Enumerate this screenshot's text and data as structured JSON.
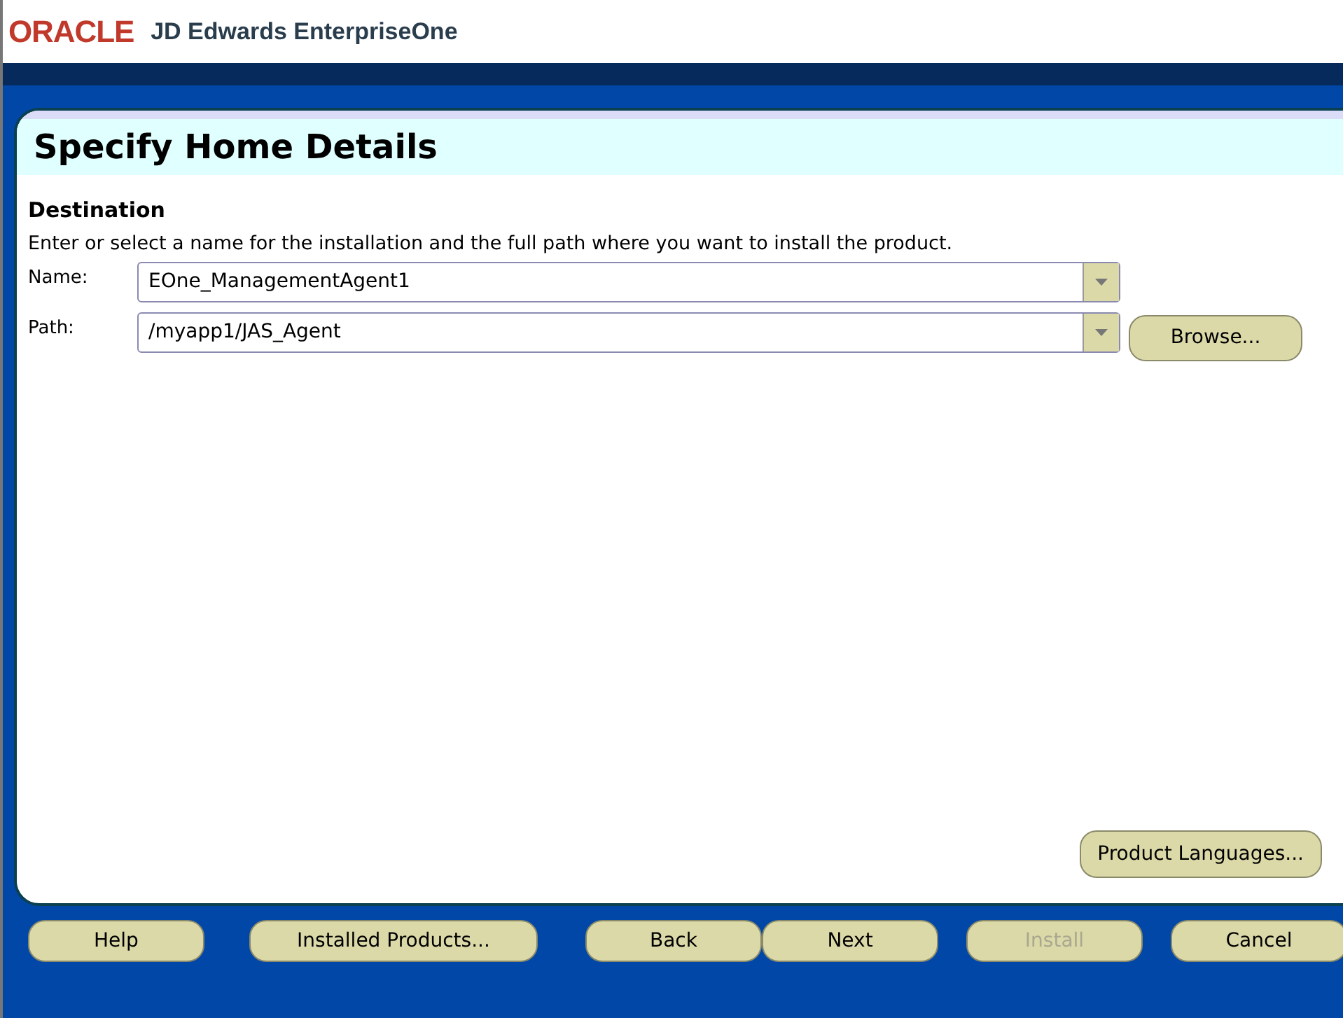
{
  "header": {
    "brand": "ORACLE",
    "product": "JD Edwards EnterpriseOne"
  },
  "page_title": "Specify Home Details",
  "section": {
    "heading": "Destination",
    "description": "Enter or select a name for the installation and the full path where you want to install the product."
  },
  "fields": [
    {
      "label": "Name:",
      "value": "EOne_ManagementAgent1"
    },
    {
      "label": "Path:",
      "value": "/myapp1/JAS_Agent",
      "browse": "Browse..."
    }
  ],
  "product_languages_button": "Product Languages...",
  "buttons": [
    {
      "label": "Help",
      "disabled": false
    },
    {
      "label": "Installed Products...",
      "disabled": false
    },
    {
      "label": "Back",
      "disabled": false
    },
    {
      "label": "Next",
      "disabled": false
    },
    {
      "label": "Install",
      "disabled": true
    },
    {
      "label": "Cancel",
      "disabled": false
    }
  ]
}
